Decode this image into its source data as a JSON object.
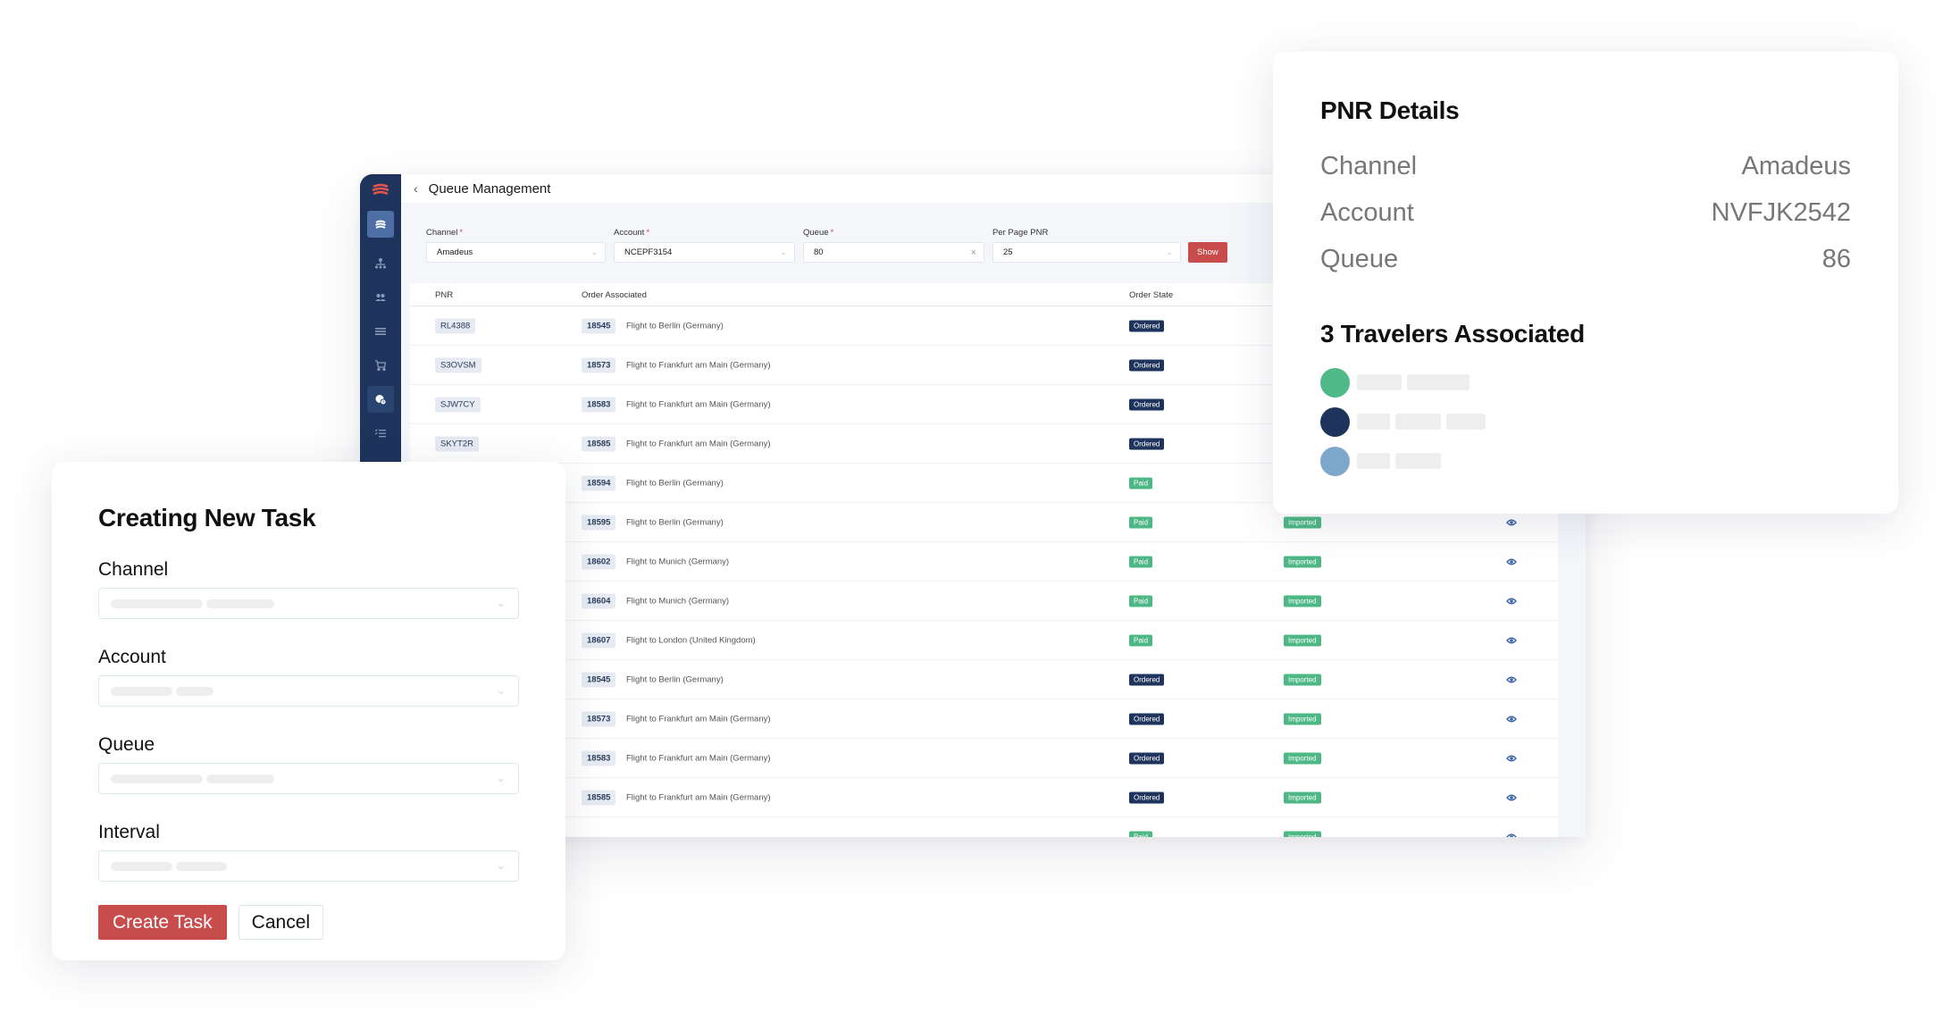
{
  "app": {
    "page_title": "Queue Management",
    "back_icon": "chevron-left-icon",
    "sidebar": [
      {
        "icon": "brand-globe-icon",
        "active": "brand"
      },
      {
        "icon": "org-chart-icon"
      },
      {
        "icon": "users-icon"
      },
      {
        "icon": "menu-lines-icon"
      },
      {
        "icon": "cart-icon"
      },
      {
        "icon": "queue-clock-icon",
        "active": "true"
      },
      {
        "icon": "checklist-icon"
      }
    ],
    "filters": {
      "channel": {
        "label": "Channel",
        "value": "Amadeus"
      },
      "account": {
        "label": "Account",
        "value": "NCEPF3154"
      },
      "queue": {
        "label": "Queue",
        "value": "80"
      },
      "per_page": {
        "label": "Per Page PNR",
        "value": "25"
      },
      "required_mark": "*",
      "show_button": "Show"
    },
    "table": {
      "headers": {
        "pnr": "PNR",
        "order": "Order Associated",
        "state": "Order State"
      },
      "rows": [
        {
          "pnr": "RL4388",
          "order_id": "18545",
          "desc": "Flight to Berlin (Germany)",
          "state": "Ordered",
          "import": ""
        },
        {
          "pnr": "S3OVSM",
          "order_id": "18573",
          "desc": "Flight to Frankfurt am Main (Germany)",
          "state": "Ordered",
          "import": ""
        },
        {
          "pnr": "SJW7CY",
          "order_id": "18583",
          "desc": "Flight to Frankfurt am Main (Germany)",
          "state": "Ordered",
          "import": ""
        },
        {
          "pnr": "SKYT2R",
          "order_id": "18585",
          "desc": "Flight to Frankfurt am Main (Germany)",
          "state": "Ordered",
          "import": ""
        },
        {
          "pnr": "",
          "order_id": "18594",
          "desc": "Flight to Berlin (Germany)",
          "state": "Paid",
          "import": ""
        },
        {
          "pnr": "",
          "order_id": "18595",
          "desc": "Flight to Berlin (Germany)",
          "state": "Paid",
          "import": "Imported"
        },
        {
          "pnr": "",
          "order_id": "18602",
          "desc": "Flight to Munich (Germany)",
          "state": "Paid",
          "import": "Imported"
        },
        {
          "pnr": "",
          "order_id": "18604",
          "desc": "Flight to Munich (Germany)",
          "state": "Paid",
          "import": "Imported"
        },
        {
          "pnr": "",
          "order_id": "18607",
          "desc": "Flight to London (United Kingdom)",
          "state": "Paid",
          "import": "Imported"
        },
        {
          "pnr": "",
          "order_id": "18545",
          "desc": "Flight to Berlin (Germany)",
          "state": "Ordered",
          "import": "Imported"
        },
        {
          "pnr": "",
          "order_id": "18573",
          "desc": "Flight to Frankfurt am Main (Germany)",
          "state": "Ordered",
          "import": "Imported"
        },
        {
          "pnr": "",
          "order_id": "18583",
          "desc": "Flight to Frankfurt am Main (Germany)",
          "state": "Ordered",
          "import": "Imported"
        },
        {
          "pnr": "",
          "order_id": "18585",
          "desc": "Flight to Frankfurt am Main (Germany)",
          "state": "Ordered",
          "import": "Imported"
        },
        {
          "pnr": "",
          "order_id": "",
          "desc": "",
          "state": "Paid",
          "import": "Imported"
        }
      ]
    }
  },
  "colors": {
    "sidebar": "#1e345c",
    "accent_red": "#c94c4c",
    "ordered_badge": "#1e345c",
    "paid_badge": "#4db885",
    "imported_badge": "#4db885",
    "eye_icon": "#3b64a8",
    "traveler_1": "#4fb987",
    "traveler_2": "#1e345c",
    "traveler_3": "#7da8cc"
  },
  "pnr_details": {
    "title": "PNR Details",
    "rows": [
      {
        "label": "Channel",
        "value": "Amadeus"
      },
      {
        "label": "Account",
        "value": "NVFJK2542"
      },
      {
        "label": "Queue",
        "value": "86"
      }
    ],
    "travelers_title": "3 Travelers Associated",
    "travelers": [
      {
        "color": "#4fb987",
        "placeholders": 2
      },
      {
        "color": "#1e345c",
        "placeholders": 3
      },
      {
        "color": "#7da8cc",
        "placeholders": 2
      }
    ]
  },
  "task": {
    "title": "Creating New Task",
    "fields": [
      {
        "label": "Channel"
      },
      {
        "label": "Account"
      },
      {
        "label": "Queue"
      },
      {
        "label": "Interval"
      }
    ],
    "create_button": "Create Task",
    "cancel_button": "Cancel"
  }
}
